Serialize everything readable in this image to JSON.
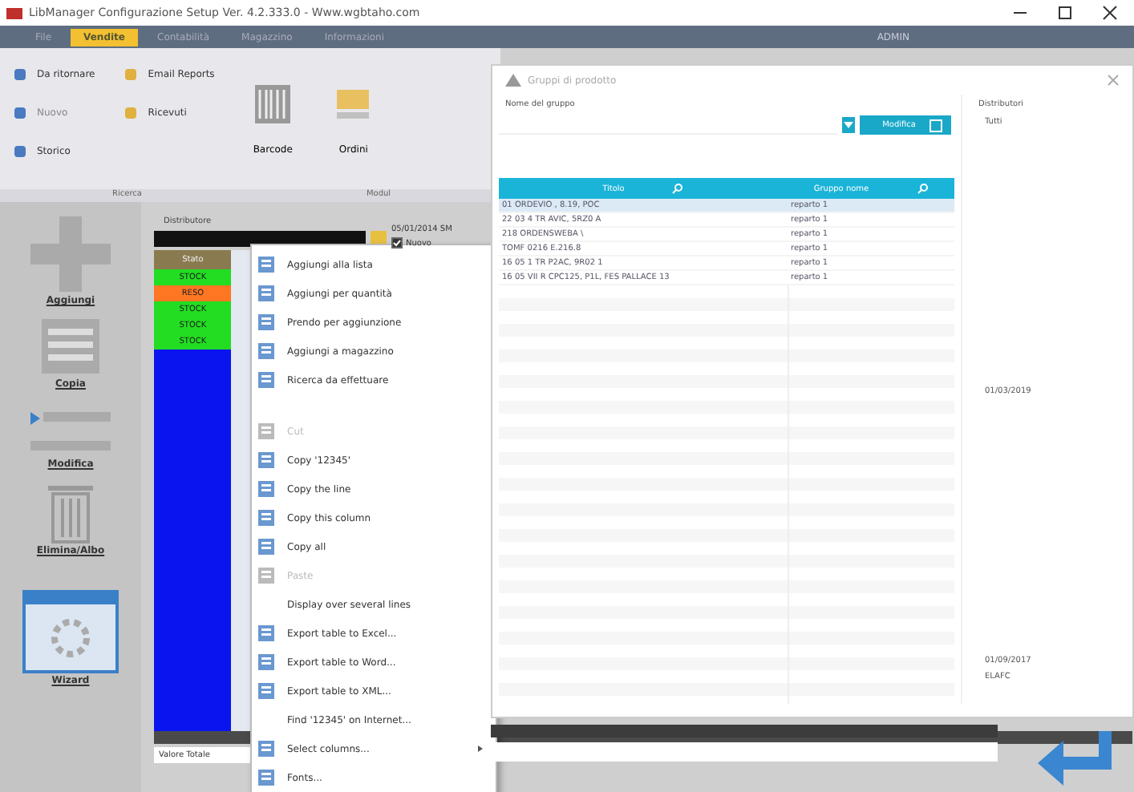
{
  "window": {
    "title": "LibManager Configurazione Setup Ver. 4.2.333.0 - Www.wgbtaho.com",
    "user": "ADMIN"
  },
  "menu": [
    {
      "label": "File",
      "selected": false
    },
    {
      "label": "Vendite",
      "selected": true
    },
    {
      "label": "Contabilità",
      "selected": false
    },
    {
      "label": "Magazzino",
      "selected": false
    },
    {
      "label": "Informazioni",
      "selected": false
    }
  ],
  "ribbon": {
    "small_buttons": [
      {
        "label": "Da ritornare",
        "disabled": false
      },
      {
        "label": "Email Reports",
        "disabled": false
      },
      {
        "label": "Nuovo",
        "disabled": true
      },
      {
        "label": "Ricevuti",
        "disabled": false
      },
      {
        "label": "Storico",
        "disabled": false
      }
    ],
    "large_buttons": [
      "Barcode",
      "Ordini"
    ],
    "groups": [
      "Ricerca",
      "Modul"
    ]
  },
  "sidebar": [
    "Aggiungi",
    "Copia",
    "Modifica",
    "Elimina/Albo",
    "Wizard"
  ],
  "filter": {
    "label": "Distributore",
    "date": "05/01/2014 SM",
    "new_label": "Nuovo",
    "new_checked": true
  },
  "grid": {
    "header": "Stato",
    "rows": [
      {
        "text": "STOCK",
        "color": "#22dd22"
      },
      {
        "text": "RESO",
        "color": "#ff7722"
      },
      {
        "text": "STOCK",
        "color": "#22dd22"
      },
      {
        "text": "STOCK",
        "color": "#22dd22"
      },
      {
        "text": "STOCK",
        "color": "#22dd22"
      }
    ],
    "total_label": "Valore Totale"
  },
  "context_menu": [
    {
      "kind": "icon",
      "label": "Aggiungi alla lista",
      "disabled": false,
      "submenu": false
    },
    {
      "kind": "icon",
      "label": "Aggiungi per quantità",
      "disabled": false,
      "submenu": false
    },
    {
      "kind": "icon",
      "label": "Prendo per aggiunzione",
      "disabled": false,
      "submenu": false
    },
    {
      "kind": "icon",
      "label": "Aggiungi a magazzino",
      "disabled": false,
      "submenu": false
    },
    {
      "kind": "icon",
      "label": "Ricerca da effettuare",
      "disabled": false,
      "submenu": false
    },
    {
      "kind": "gap"
    },
    {
      "kind": "icon",
      "label": "Cut",
      "disabled": true,
      "submenu": false
    },
    {
      "kind": "icon",
      "label": "Copy '12345'",
      "disabled": false,
      "submenu": false
    },
    {
      "kind": "icon",
      "label": "Copy the line",
      "disabled": false,
      "submenu": false
    },
    {
      "kind": "icon",
      "label": "Copy this column",
      "disabled": false,
      "submenu": false
    },
    {
      "kind": "icon",
      "label": "Copy all",
      "disabled": false,
      "submenu": false
    },
    {
      "kind": "icon",
      "label": "Paste",
      "disabled": true,
      "submenu": false
    },
    {
      "kind": "plain",
      "label": "Display over several lines",
      "disabled": false,
      "submenu": false
    },
    {
      "kind": "icon",
      "label": "Export table to Excel...",
      "disabled": false,
      "submenu": false
    },
    {
      "kind": "icon",
      "label": "Export table to Word...",
      "disabled": false,
      "submenu": false
    },
    {
      "kind": "icon",
      "label": "Export table to XML...",
      "disabled": false,
      "submenu": false
    },
    {
      "kind": "plain",
      "label": "Find '12345' on Internet...",
      "disabled": false,
      "submenu": false
    },
    {
      "kind": "icon",
      "label": "Select columns...",
      "disabled": false,
      "submenu": true
    },
    {
      "kind": "icon",
      "label": "Fonts...",
      "disabled": false,
      "submenu": false
    }
  ],
  "dialog": {
    "title": "Gruppi di prodotto",
    "name_label": "Nome del gruppo",
    "edit_button": "Modifica",
    "distributors_label": "Distributori",
    "columns": [
      "Titolo",
      "Gruppo nome"
    ],
    "rows": [
      {
        "cells": [
          "01 ORDEVIO , 8.19, POC",
          "reparto 1"
        ],
        "selected": true
      },
      {
        "cells": [
          "22 03 4 TR AVIC, 5RZ0 A",
          "reparto 1"
        ],
        "selected": false
      },
      {
        "cells": [
          "218 ORDENSWEBA \\",
          "reparto 1"
        ],
        "selected": false
      },
      {
        "cells": [
          "TOMF 0216 E.216.8",
          "reparto 1"
        ],
        "selected": false
      },
      {
        "cells": [
          "16 05 1 TR P2AC, 9R02 1",
          "reparto 1"
        ],
        "selected": false
      },
      {
        "cells": [
          "16 05 VII R CPC125, P1L, FES PALLACE 13",
          "reparto 1"
        ],
        "selected": false
      }
    ],
    "distributors_top": [
      "Tutti"
    ],
    "distributors_middle": [
      "01/03/2019"
    ],
    "distributors_bottom": [
      "01/09/2017",
      "ELAFC"
    ]
  }
}
